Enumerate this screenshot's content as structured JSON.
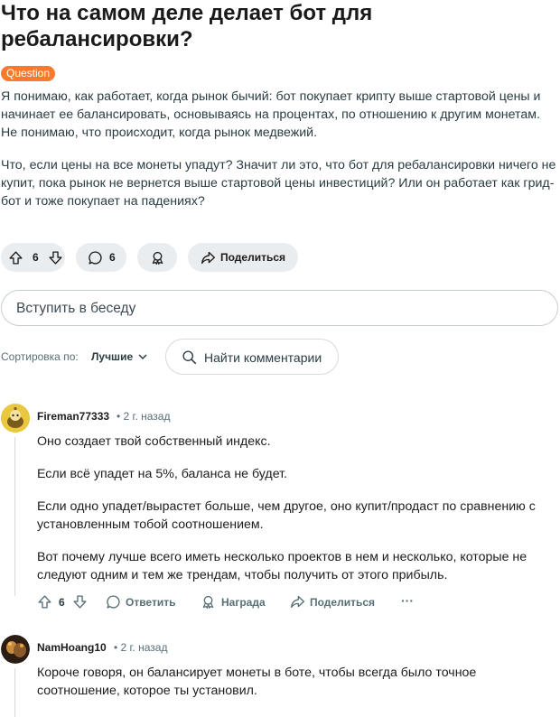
{
  "post": {
    "title": "Что на самом деле делает бот для ребалансировки?",
    "flair": "Question",
    "body": [
      "Я понимаю, как работает, когда рынок бычий: бот покупает крипту выше стартовой цены и начинает ее балансировать, основываясь на процентах, по отношению к другим монетам. Не понимаю, что происходит, когда рынок медвежий.",
      "Что, если цены на все монеты упадут? Значит ли это, что бот для ребалансировки ничего не купит, пока рынок не вернется выше стартовой цены инвестиций? Или он работает как грид-бот и тоже покупает на падениях?"
    ],
    "votes": "6",
    "comments_count": "6",
    "share_label": "Поделиться"
  },
  "join_placeholder": "Вступить в беседу",
  "sort": {
    "label": "Сортировка по:",
    "value": "Лучшие"
  },
  "find_comments": "Найти комментарии",
  "comments": [
    {
      "author": "Fireman77333",
      "time": "• 2 г. назад",
      "paragraphs": [
        "Оно создает твой собственный индекс.",
        "Если всё упадет на 5%, баланса не будет.",
        "Если одно упадет/вырастет больше, чем другое, оно купит/продаст по сравнению с установленным тобой соотношением.",
        "Вот почему лучше всего иметь несколько проектов в нем и несколько, которые не следуют одним и тем же трендам, чтобы получить от этого прибыль."
      ],
      "votes": "6",
      "reply": "Ответить",
      "award": "Награда",
      "share": "Поделиться",
      "more": "···"
    },
    {
      "author": "NamHoang10",
      "time": "• 2 г. назад",
      "paragraphs": [
        "Короче говоря, он балансирует монеты в боте, чтобы всегда было точное соотношение, которое ты установил."
      ]
    }
  ],
  "colors": {
    "flair": "#f97a2d",
    "pill_bg": "#e9edf0",
    "meta": "#576f76"
  },
  "icons": [
    "upvote-icon",
    "downvote-icon",
    "comment-icon",
    "award-icon",
    "share-icon",
    "search-icon",
    "chevron-down-icon",
    "more-icon"
  ]
}
